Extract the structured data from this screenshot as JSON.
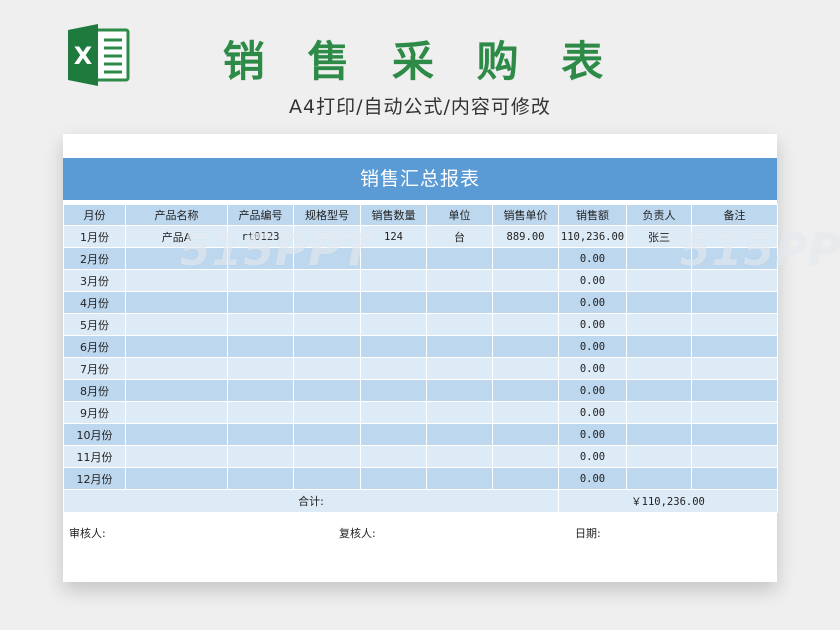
{
  "header": {
    "title": "销 售 采 购 表",
    "subtitle": "A4打印/自动公式/内容可修改",
    "logo_letter": "X"
  },
  "sheet": {
    "title": "销售汇总报表",
    "columns": [
      "月份",
      "产品名称",
      "产品编号",
      "规格型号",
      "销售数量",
      "单位",
      "销售单价",
      "销售额",
      "负责人",
      "备注"
    ],
    "rows": [
      {
        "month": "1月份",
        "product": "产品A",
        "code": "rt0123",
        "spec": "",
        "qty": "124",
        "unit": "台",
        "price": "889.00",
        "amount": "110,236.00",
        "owner": "张三",
        "note": ""
      },
      {
        "month": "2月份",
        "product": "",
        "code": "",
        "spec": "",
        "qty": "",
        "unit": "",
        "price": "",
        "amount": "0.00",
        "owner": "",
        "note": ""
      },
      {
        "month": "3月份",
        "product": "",
        "code": "",
        "spec": "",
        "qty": "",
        "unit": "",
        "price": "",
        "amount": "0.00",
        "owner": "",
        "note": ""
      },
      {
        "month": "4月份",
        "product": "",
        "code": "",
        "spec": "",
        "qty": "",
        "unit": "",
        "price": "",
        "amount": "0.00",
        "owner": "",
        "note": ""
      },
      {
        "month": "5月份",
        "product": "",
        "code": "",
        "spec": "",
        "qty": "",
        "unit": "",
        "price": "",
        "amount": "0.00",
        "owner": "",
        "note": ""
      },
      {
        "month": "6月份",
        "product": "",
        "code": "",
        "spec": "",
        "qty": "",
        "unit": "",
        "price": "",
        "amount": "0.00",
        "owner": "",
        "note": ""
      },
      {
        "month": "7月份",
        "product": "",
        "code": "",
        "spec": "",
        "qty": "",
        "unit": "",
        "price": "",
        "amount": "0.00",
        "owner": "",
        "note": ""
      },
      {
        "month": "8月份",
        "product": "",
        "code": "",
        "spec": "",
        "qty": "",
        "unit": "",
        "price": "",
        "amount": "0.00",
        "owner": "",
        "note": ""
      },
      {
        "month": "9月份",
        "product": "",
        "code": "",
        "spec": "",
        "qty": "",
        "unit": "",
        "price": "",
        "amount": "0.00",
        "owner": "",
        "note": ""
      },
      {
        "month": "10月份",
        "product": "",
        "code": "",
        "spec": "",
        "qty": "",
        "unit": "",
        "price": "",
        "amount": "0.00",
        "owner": "",
        "note": ""
      },
      {
        "month": "11月份",
        "product": "",
        "code": "",
        "spec": "",
        "qty": "",
        "unit": "",
        "price": "",
        "amount": "0.00",
        "owner": "",
        "note": ""
      },
      {
        "month": "12月份",
        "product": "",
        "code": "",
        "spec": "",
        "qty": "",
        "unit": "",
        "price": "",
        "amount": "0.00",
        "owner": "",
        "note": ""
      }
    ],
    "total_label": "合计:",
    "total_value": "￥110,236.00",
    "footer": {
      "reviewer": "审核人:",
      "rechecker": "复核人:",
      "date": "日期:"
    }
  },
  "watermark": "515PPT",
  "colors": {
    "title_green": "#2e8b47",
    "banner_blue": "#5b9bd5",
    "row_light": "#ddebf7",
    "row_dark": "#bdd7ee"
  }
}
